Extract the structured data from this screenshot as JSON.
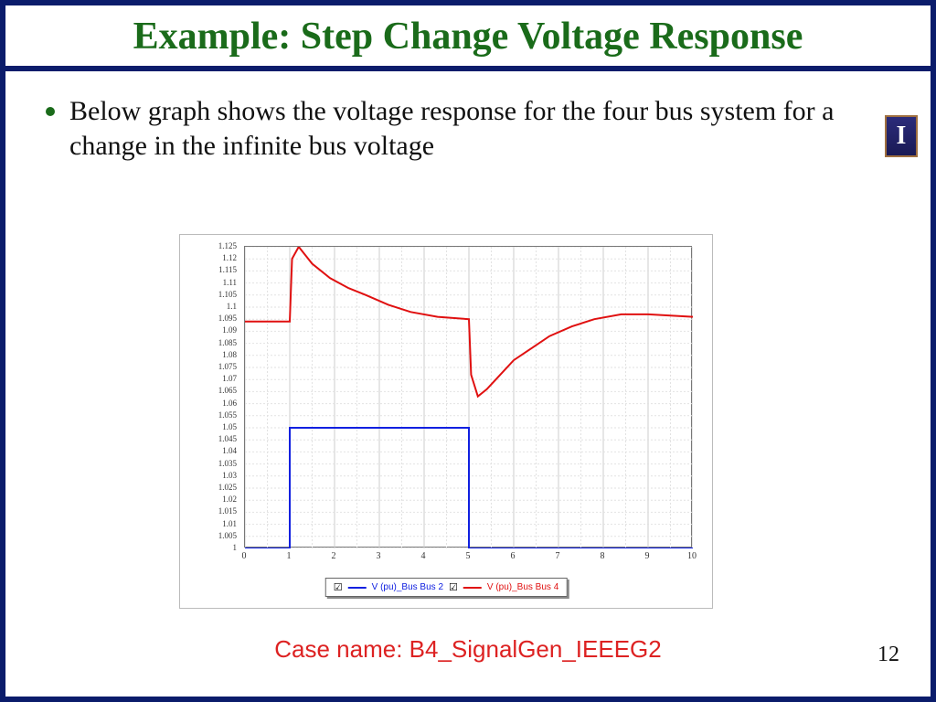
{
  "title": "Example: Step Change Voltage Response",
  "bullet": "Below graph shows the voltage response for the four bus system for a change in the infinite bus voltage",
  "case_name": "Case name: B4_SignalGen_IEEEG2",
  "page_number": "12",
  "logo_letter": "I",
  "legend": {
    "a": "V (pu)_Bus Bus 2",
    "b": "V (pu)_Bus Bus 4"
  },
  "chart_data": {
    "type": "line",
    "title": "",
    "xlabel": "",
    "ylabel": "",
    "xlim": [
      0,
      10
    ],
    "ylim": [
      1.0,
      1.125
    ],
    "xticks": [
      0,
      1,
      2,
      3,
      4,
      5,
      6,
      7,
      8,
      9,
      10
    ],
    "yticks": [
      1,
      1.005,
      1.01,
      1.015,
      1.02,
      1.025,
      1.03,
      1.035,
      1.04,
      1.045,
      1.05,
      1.055,
      1.06,
      1.065,
      1.07,
      1.075,
      1.08,
      1.085,
      1.09,
      1.095,
      1.1,
      1.105,
      1.11,
      1.115,
      1.12,
      1.125
    ],
    "series": [
      {
        "name": "V (pu)_Bus Bus 2",
        "color": "#1020e0",
        "x": [
          0,
          1,
          1,
          5,
          5,
          10
        ],
        "y": [
          1.0,
          1.0,
          1.05,
          1.05,
          1.0,
          1.0
        ]
      },
      {
        "name": "V (pu)_Bus Bus 4",
        "color": "#e01010",
        "x": [
          0,
          1,
          1.05,
          1.2,
          1.5,
          1.9,
          2.3,
          2.7,
          3.2,
          3.7,
          4.3,
          5.0,
          5.05,
          5.2,
          5.4,
          5.7,
          6.0,
          6.4,
          6.8,
          7.3,
          7.8,
          8.4,
          9.0,
          10.0
        ],
        "y": [
          1.094,
          1.094,
          1.12,
          1.125,
          1.118,
          1.112,
          1.108,
          1.105,
          1.101,
          1.098,
          1.096,
          1.095,
          1.072,
          1.063,
          1.066,
          1.072,
          1.078,
          1.083,
          1.088,
          1.092,
          1.095,
          1.097,
          1.097,
          1.096
        ]
      }
    ]
  }
}
